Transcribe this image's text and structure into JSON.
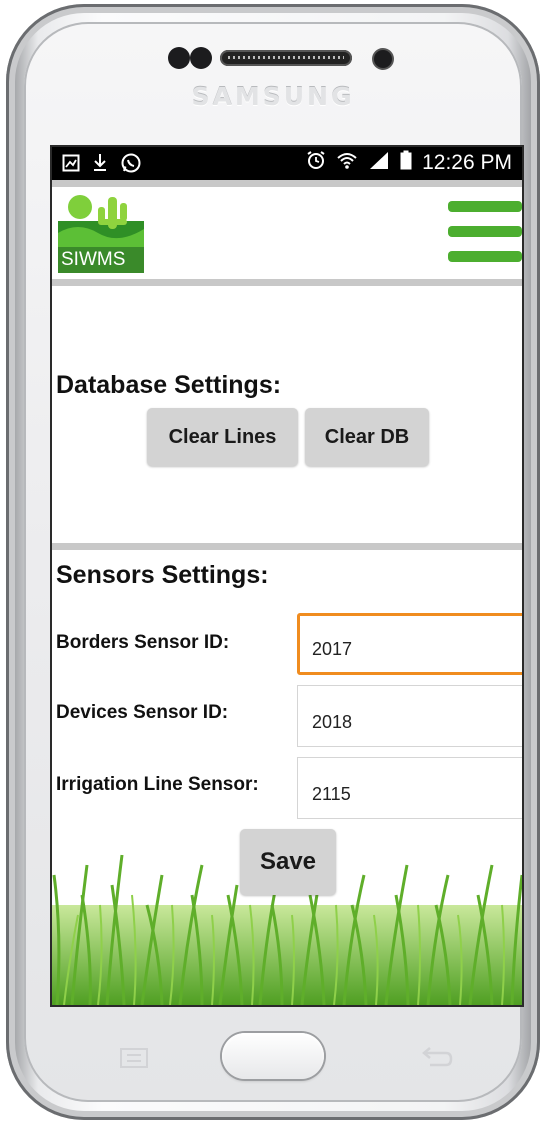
{
  "device": {
    "brand": "SAMSUNG"
  },
  "statusbar": {
    "time": "12:26 PM",
    "icons_left": [
      "image-notification-icon",
      "download-icon",
      "whatsapp-icon"
    ],
    "icons_right": [
      "alarm-icon",
      "wifi-icon",
      "signal-icon",
      "battery-icon"
    ]
  },
  "header": {
    "logo_text": "SIWMS",
    "menu_icon": "hamburger-menu-icon"
  },
  "database": {
    "title": "Database Settings:",
    "clear_lines_label": "Clear Lines",
    "clear_db_label": "Clear DB"
  },
  "sensors": {
    "title": "Sensors Settings:",
    "fields": [
      {
        "label": "Borders Sensor ID:",
        "value": "2017"
      },
      {
        "label": "Devices Sensor ID:",
        "value": "2018"
      },
      {
        "label": "Irrigation Line Sensor:",
        "value": "2115"
      }
    ],
    "save_label": "Save"
  },
  "colors": {
    "accent_green": "#4cae2f",
    "focus_orange": "#f08c1f",
    "button_gray": "#d3d3d3",
    "divider_gray": "#c8c8c8"
  }
}
